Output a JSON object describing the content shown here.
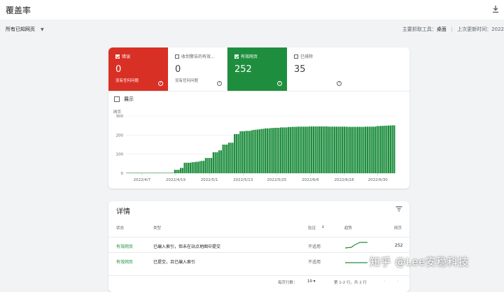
{
  "header": {
    "title": "覆盖率"
  },
  "filter": {
    "selected": "所有已知网页"
  },
  "meta": {
    "crawler_label": "主要抓取工具：",
    "crawler_value": "桌面",
    "updated_label": "上次更新时间：2022"
  },
  "tiles": [
    {
      "label": "错误",
      "value": "0",
      "sub": "没有任何问题",
      "checked": true
    },
    {
      "label": "收到警告的有效...",
      "value": "0",
      "sub": "没有任何问题",
      "checked": false
    },
    {
      "label": "有效网页",
      "value": "252",
      "sub": "",
      "checked": true
    },
    {
      "label": "已排除",
      "value": "35",
      "sub": "",
      "checked": false
    }
  ],
  "show_toggle": {
    "label": "展示"
  },
  "chart_data": {
    "type": "bar",
    "ylabel": "网页",
    "yticks": [
      "300",
      "200",
      "100",
      "0"
    ],
    "ylim": [
      0,
      300
    ],
    "xticks": [
      "2022/4/7",
      "2022/4/19",
      "2022/5/1",
      "2022/5/13",
      "2022/5/25",
      "2022/6/6",
      "2022/6/18",
      "2022/6/30"
    ],
    "color": "#1e8e3e",
    "values": [
      0,
      0,
      0,
      0,
      0,
      0,
      0,
      0,
      0,
      0,
      0,
      0,
      0,
      0,
      0,
      0,
      0,
      0,
      0,
      0,
      0,
      0,
      0,
      0,
      0,
      18,
      18,
      18,
      28,
      28,
      55,
      55,
      55,
      55,
      58,
      58,
      60,
      60,
      63,
      65,
      65,
      80,
      80,
      80,
      80,
      110,
      110,
      110,
      120,
      120,
      150,
      150,
      150,
      160,
      160,
      160,
      205,
      205,
      205,
      220,
      220,
      220,
      222,
      222,
      222,
      225,
      227,
      228,
      229,
      230,
      232,
      233,
      235,
      235,
      235,
      237,
      237,
      238,
      238,
      238,
      240,
      240,
      240,
      240,
      242,
      242,
      243,
      243,
      243,
      244,
      244,
      244,
      244,
      244,
      244,
      245,
      245,
      245,
      245,
      245,
      245,
      245,
      245,
      245,
      245,
      244,
      244,
      244,
      244,
      244,
      244,
      244,
      244,
      244,
      244,
      243,
      243,
      243,
      243,
      243,
      243,
      243,
      243,
      243,
      244,
      244,
      244,
      244,
      244,
      244,
      247,
      247,
      248,
      248,
      249,
      249,
      250,
      250,
      251,
      251
    ]
  },
  "details": {
    "title": "详情",
    "columns": [
      "状态",
      "类型",
      "验证",
      "趋势",
      "网页"
    ],
    "rows": [
      {
        "status": "有效网页",
        "type": "已编入索引，但未在站点地图中提交",
        "validation": "不适用",
        "pages": "252"
      },
      {
        "status": "有效网页",
        "type": "已提交，且已编入索引",
        "validation": "不适用",
        "pages": ""
      }
    ],
    "pager": {
      "rows_label": "每页行数：",
      "rows_value": "10",
      "range": "第 1-2 行，共 2 行"
    }
  },
  "watermark": "知乎 @Lee安稳科技"
}
